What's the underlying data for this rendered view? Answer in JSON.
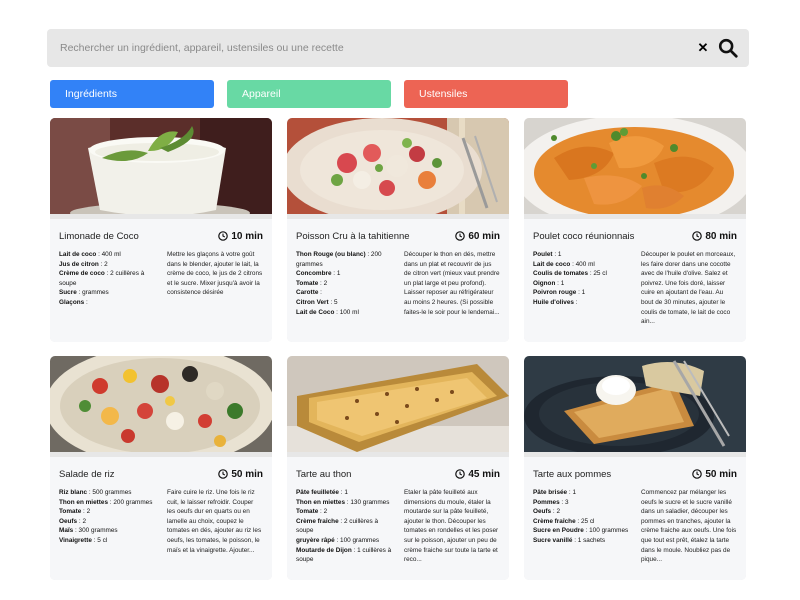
{
  "search": {
    "placeholder": "Rechercher un ingrédient, appareil, ustensiles ou une recette",
    "clear_icon": "close-icon",
    "search_icon": "search-icon"
  },
  "filters": {
    "ingredients_label": "Ingrédients",
    "appliances_label": "Appareil",
    "utensils_label": "Ustensiles",
    "colors": {
      "ingredients": "#3282f7",
      "appliances": "#68d9a4",
      "utensils": "#ed6454"
    }
  },
  "recipes": [
    {
      "title": "Limonade de Coco",
      "time": "10 min",
      "ingredients": [
        {
          "name": "Lait de coco",
          "qty": ": 400 ml"
        },
        {
          "name": "Jus de citron",
          "qty": ": 2"
        },
        {
          "name": "Crème de coco",
          "qty": ": 2 cuillères à soupe"
        },
        {
          "name": "Sucre",
          "qty": ": grammes"
        },
        {
          "name": "Glaçons",
          "qty": ":"
        }
      ],
      "description": "Mettre les glaçons à votre goût dans le blender, ajouter le lait, la crème de coco, le jus de 2 citrons et le sucre. Mixer jusqu'à avoir la consistence désirée"
    },
    {
      "title": "Poisson Cru à la tahitienne",
      "time": "60 min",
      "ingredients": [
        {
          "name": "Thon Rouge (ou blanc)",
          "qty": ": 200 grammes"
        },
        {
          "name": "Concombre",
          "qty": ": 1"
        },
        {
          "name": "Tomate",
          "qty": ": 2"
        },
        {
          "name": "Carotte",
          "qty": ":"
        },
        {
          "name": "Citron Vert",
          "qty": ": 5"
        },
        {
          "name": "Lait de Coco",
          "qty": ": 100 ml"
        }
      ],
      "description": "Découper le thon en dés, mettre dans un plat et recouvrir de jus de citron vert (mieux vaut prendre un plat large et peu profond). Laisser reposer au réfrigérateur au moins 2 heures. (Si possible faites-le le soir pour le lendemai..."
    },
    {
      "title": "Poulet coco réunionnais",
      "time": "80 min",
      "ingredients": [
        {
          "name": "Poulet",
          "qty": ": 1"
        },
        {
          "name": "Lait de coco",
          "qty": ": 400 ml"
        },
        {
          "name": "Coulis de tomates",
          "qty": ": 25 cl"
        },
        {
          "name": "Oignon",
          "qty": ": 1"
        },
        {
          "name": "Poivron rouge",
          "qty": ": 1"
        },
        {
          "name": "Huile d'olives",
          "qty": ":"
        }
      ],
      "description": "Découper le poulet en morceaux, les faire dorer dans une cocotte avec de l'huile d'olive. Salez et poivrez. Une fois doré, laisser cuire en ajoutant de l'eau. Au bout de 30 minutes, ajouter le coulis de tomate, le lait de coco ain..."
    },
    {
      "title": "Salade de riz",
      "time": "50 min",
      "ingredients": [
        {
          "name": "Riz blanc",
          "qty": ": 500 grammes"
        },
        {
          "name": "Thon en miettes",
          "qty": ": 200 grammes"
        },
        {
          "name": "Tomate",
          "qty": ": 2"
        },
        {
          "name": "Oeufs",
          "qty": ": 2"
        },
        {
          "name": "Maïs",
          "qty": ": 300 grammes"
        },
        {
          "name": "Vinaigrette",
          "qty": ": 5 cl"
        }
      ],
      "description": "Faire cuire le riz. Une fois le riz cuit, le laisser refroidir. Couper les oeufs dur en quarts ou en lamelle au choix, coupez le tomates en dés, ajouter au riz les oeufs, les tomates, le poisson, le maïs et la vinaigrette. Ajouter..."
    },
    {
      "title": "Tarte au thon",
      "time": "45 min",
      "ingredients": [
        {
          "name": "Pâte feuilletée",
          "qty": ": 1"
        },
        {
          "name": "Thon en miettes",
          "qty": ": 130 grammes"
        },
        {
          "name": "Tomate",
          "qty": ": 2"
        },
        {
          "name": "Crème fraîche",
          "qty": ": 2 cuillères à soupe"
        },
        {
          "name": "gruyère râpé",
          "qty": ": 100 grammes"
        },
        {
          "name": "Moutarde de Dijon",
          "qty": ": 1 cuillères à soupe"
        }
      ],
      "description": "Etaler la pâte feuilleté aux dimensions du moule, étaler la moutarde sur la pâte feuilleté, ajouter le thon. Découper les tomates en rondelles et les poser sur le poisson, ajouter un peu de crème fraiche sur toute la tarte et reco..."
    },
    {
      "title": "Tarte aux pommes",
      "time": "50 min",
      "ingredients": [
        {
          "name": "Pâte brisée",
          "qty": ": 1"
        },
        {
          "name": "Pommes",
          "qty": ": 3"
        },
        {
          "name": "Oeufs",
          "qty": ": 2"
        },
        {
          "name": "Crème fraîche",
          "qty": ": 25 cl"
        },
        {
          "name": "Sucre en Poudre",
          "qty": ": 100 grammes"
        },
        {
          "name": "Sucre vanillé",
          "qty": ": 1 sachets"
        }
      ],
      "description": "Commencez par mélanger les oeufs le sucre et le sucre vanillé dans un saladier, découper les pommes en tranches, ajouter la crème fraiche aux oeufs. Une fois que tout est prêt, étalez la tarte dans le moule. Noubliez pas de pique..."
    }
  ]
}
